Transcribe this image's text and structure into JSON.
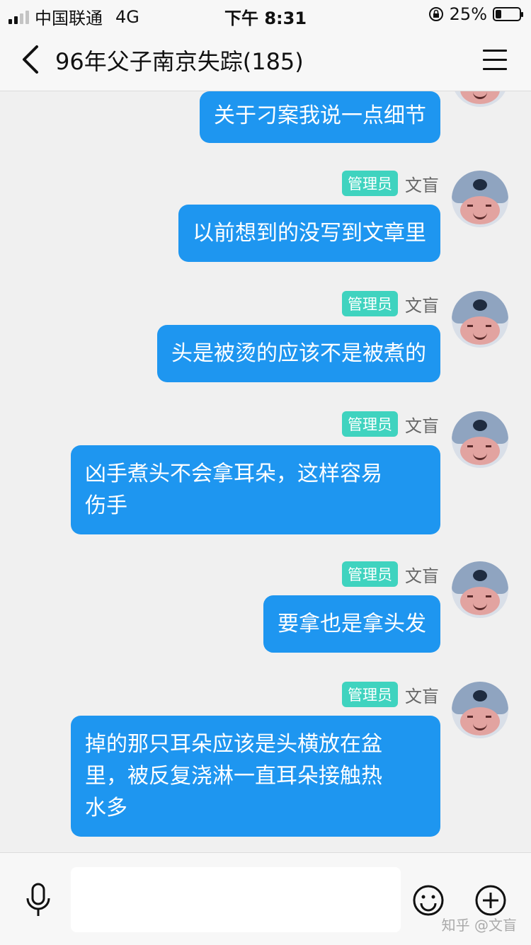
{
  "status": {
    "carrier": "中国联通",
    "network": "4G",
    "time": "下午 8:31",
    "battery": "25%",
    "battery_level": 0.25
  },
  "header": {
    "back_icon": "chevron-left-icon",
    "title": "96年父子南京失踪(185)",
    "menu_icon": "hamburger-menu-icon"
  },
  "messages": [
    {
      "badge": "",
      "sender": "",
      "text": "关于刁案我说一点细节"
    },
    {
      "badge": "管理员",
      "sender": "文盲",
      "text": "以前想到的没写到文章里"
    },
    {
      "badge": "管理员",
      "sender": "文盲",
      "text": "头是被烫的应该不是被煮的"
    },
    {
      "badge": "管理员",
      "sender": "文盲",
      "text": "凶手煮头不会拿耳朵，这样容易\n伤手"
    },
    {
      "badge": "管理员",
      "sender": "文盲",
      "text": "要拿也是拿头发"
    },
    {
      "badge": "管理员",
      "sender": "文盲",
      "text": "掉的那只耳朵应该是头横放在盆\n里，被反复浇淋一直耳朵接触热\n水多"
    }
  ],
  "input": {
    "placeholder": ""
  },
  "icons": {
    "mic": "microphone-icon",
    "emoji": "emoji-icon",
    "plus": "plus-icon"
  },
  "watermark": "知乎 @文盲",
  "colors": {
    "bubble": "#1e96f0",
    "badge": "#3fd3bf"
  }
}
